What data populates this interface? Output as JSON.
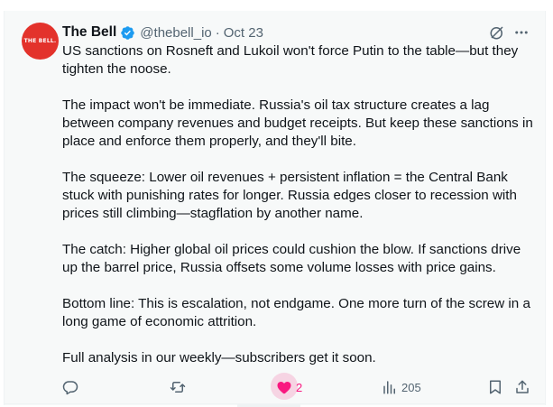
{
  "author": {
    "name": "The Bell",
    "handle": "@thebell_io",
    "separator": "·",
    "date": "Oct 23",
    "avatar_text": "THE BELL."
  },
  "tweet": {
    "paragraphs": [
      "US sanctions on Rosneft and Lukoil won't force Putin to the table—but they tighten the noose.",
      "The impact won't be immediate. Russia's oil tax structure creates a lag between company revenues and budget receipts. But keep these sanctions in place and enforce them properly, and they'll bite.",
      "The squeeze: Lower oil revenues + persistent inflation = the Central Bank stuck with punishing rates for longer. Russia edges closer to recession with prices still climbing—stagflation by another name.",
      "The catch: Higher global oil prices could cushion the blow. If sanctions drive up the barrel price, Russia offsets some volume losses with price gains.",
      "Bottom line: This is escalation, not endgame. One more turn of the screw in a long game of economic attrition.",
      "Full analysis in our weekly—subscribers get it soon."
    ]
  },
  "actions": {
    "reply": {
      "icon": "reply-icon"
    },
    "retweet": {
      "icon": "retweet-icon"
    },
    "like": {
      "icon": "heart-icon",
      "count": "2",
      "liked": true
    },
    "views": {
      "icon": "views-icon",
      "count": "205"
    },
    "bookmark": {
      "icon": "bookmark-icon"
    },
    "share": {
      "icon": "share-icon"
    }
  },
  "colors": {
    "avatar_bg": "#e3322b",
    "verified": "#1d9bf0",
    "like": "#f91880",
    "muted": "#536471"
  }
}
